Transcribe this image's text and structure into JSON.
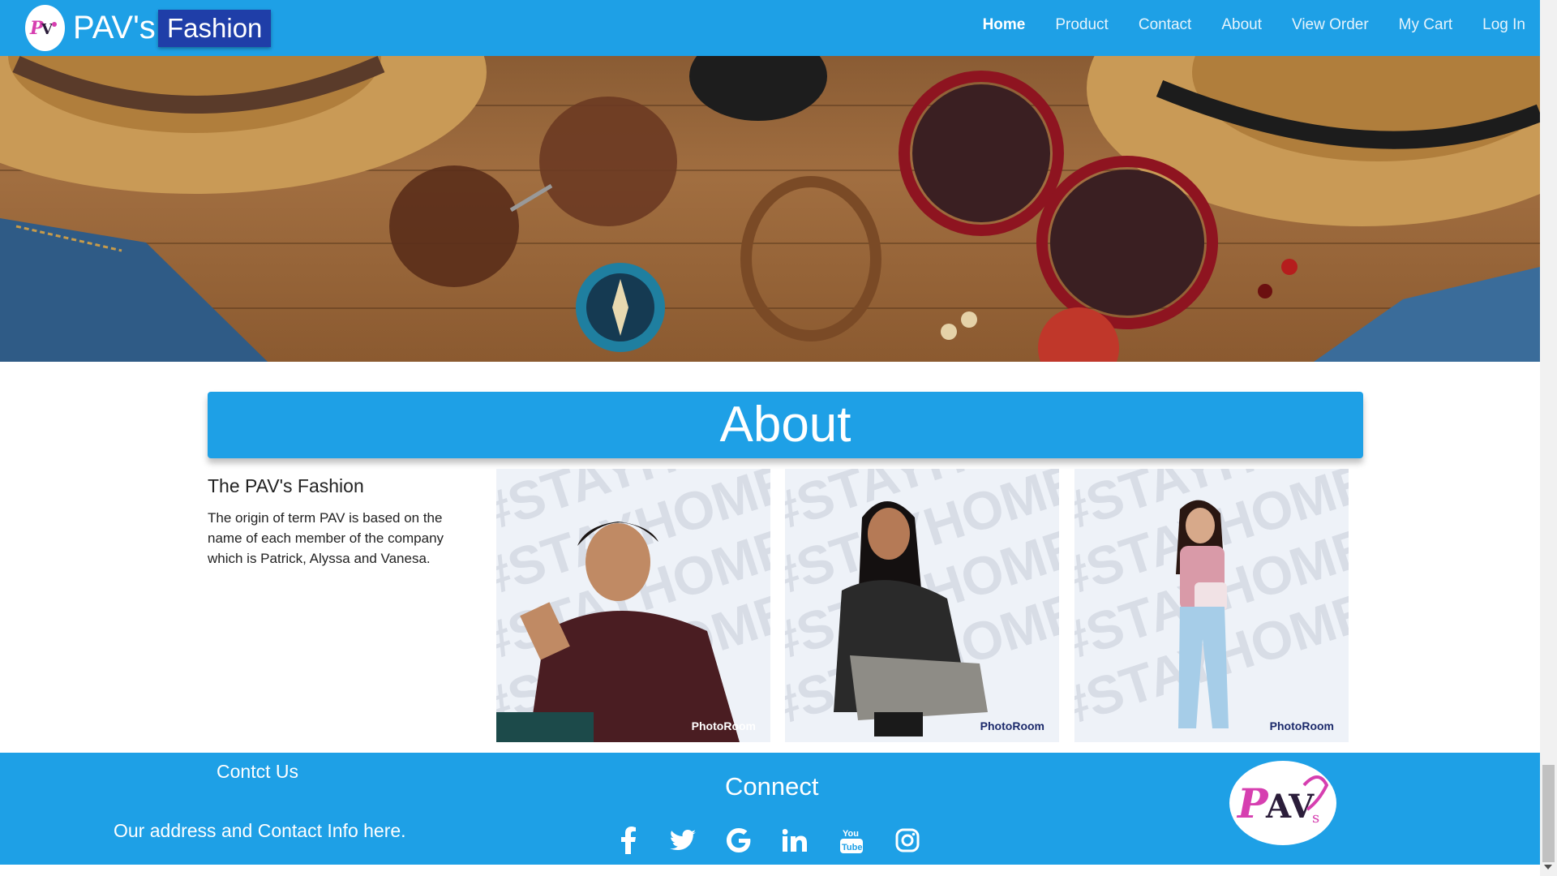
{
  "brand": {
    "name": "PAV's",
    "tag": "Fashion",
    "logo_text": "PAV's"
  },
  "nav": {
    "items": [
      {
        "label": "Home",
        "active": true
      },
      {
        "label": "Product",
        "active": false
      },
      {
        "label": "Contact",
        "active": false
      },
      {
        "label": "About",
        "active": false
      },
      {
        "label": "View Order",
        "active": false
      },
      {
        "label": "My Cart",
        "active": false
      },
      {
        "label": "Log In",
        "active": false
      }
    ]
  },
  "about": {
    "banner_title": "About",
    "heading": "The PAV's Fashion",
    "description": "The origin of term PAV is based on the name of each member of the company which is Patrick, Alyssa and Vanesa.",
    "photo_watermark": "#STAYHOME",
    "photo_badge": "PhotoRoom"
  },
  "footer": {
    "contact_title": "Contct Us",
    "contact_text": "Our address and Contact Info here.",
    "connect_title": "Connect",
    "social_icons": [
      "facebook-icon",
      "twitter-icon",
      "google-icon",
      "linkedin-icon",
      "youtube-icon",
      "instagram-icon"
    ],
    "youtube_text": "You Tube"
  },
  "colors": {
    "primary": "#1ea0e6",
    "brand_box": "#1f3ea8",
    "logo_pink": "#d63fb0"
  }
}
